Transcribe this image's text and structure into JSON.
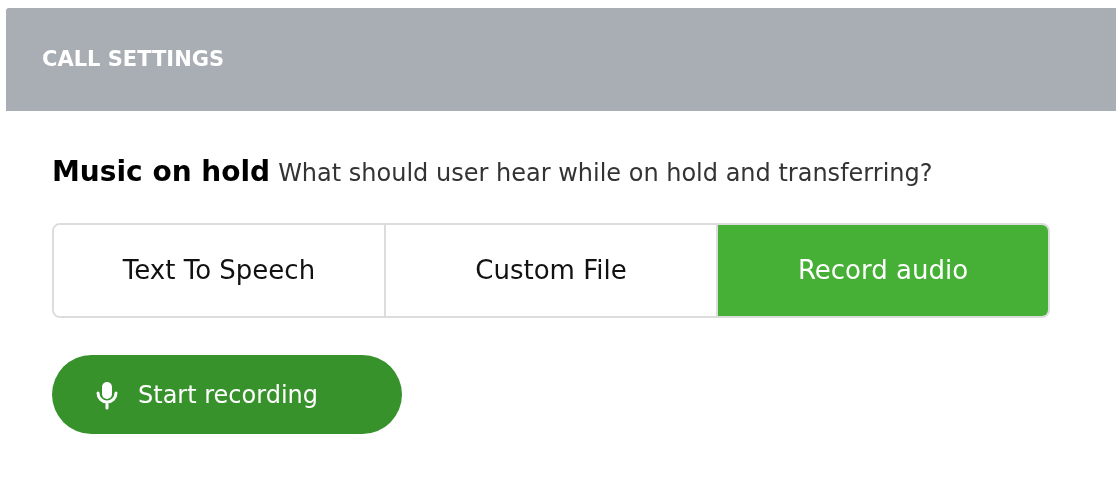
{
  "header": {
    "title": "CALL SETTINGS"
  },
  "section": {
    "title": "Music on hold",
    "description": "What should user hear while on hold and transferring?"
  },
  "options": [
    {
      "label": "Text To Speech",
      "selected": false
    },
    {
      "label": "Custom File",
      "selected": false
    },
    {
      "label": "Record audio",
      "selected": true
    }
  ],
  "record_button": {
    "label": "Start recording"
  }
}
